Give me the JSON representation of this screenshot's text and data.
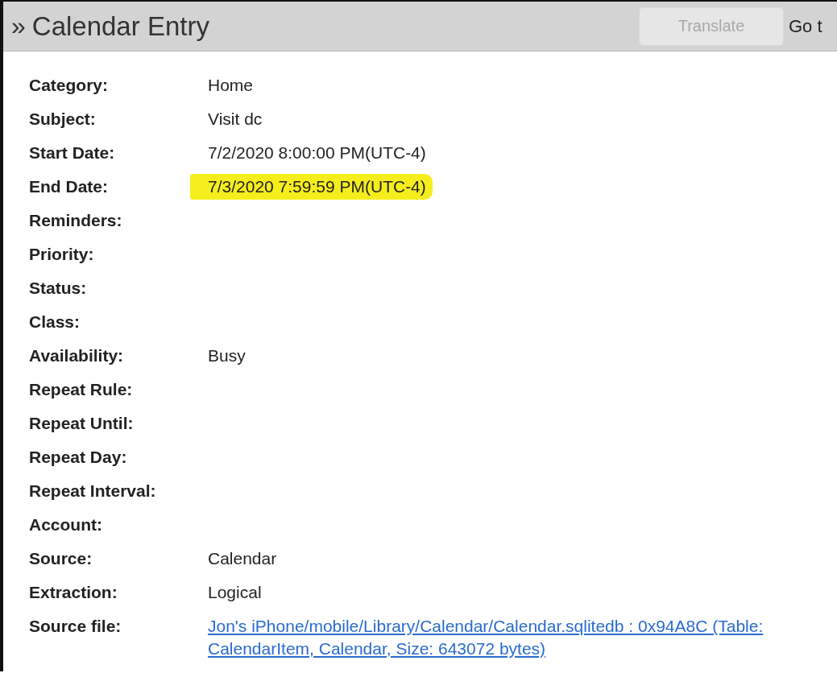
{
  "header": {
    "icon": "»",
    "title": "Calendar Entry",
    "translate_button": {
      "label": "Translate",
      "disabled": true
    },
    "go_to_link": "Go t"
  },
  "fields": [
    {
      "label": "Category:",
      "value": "Home",
      "kind": "text",
      "highlighted": false
    },
    {
      "label": "Subject:",
      "value": "Visit dc",
      "kind": "text",
      "highlighted": false
    },
    {
      "label": "Start Date:",
      "value": "7/2/2020 8:00:00 PM(UTC-4)",
      "kind": "text",
      "highlighted": false
    },
    {
      "label": "End Date:",
      "value": "7/3/2020 7:59:59 PM(UTC-4)",
      "kind": "text",
      "highlighted": true
    },
    {
      "label": "Reminders:",
      "highlighted": false
    },
    {
      "label": "Priority:",
      "highlighted": false
    },
    {
      "label": "Status:",
      "highlighted": false
    },
    {
      "label": "Class:",
      "highlighted": false
    },
    {
      "label": "Availability:",
      "value": "Busy",
      "kind": "text",
      "highlighted": false
    },
    {
      "label": "Repeat Rule:",
      "highlighted": false
    },
    {
      "label": "Repeat Until:",
      "highlighted": false
    },
    {
      "label": "Repeat Day:",
      "highlighted": false
    },
    {
      "label": "Repeat Interval:",
      "highlighted": false
    },
    {
      "label": "Account:",
      "highlighted": false
    },
    {
      "label": "Source:",
      "value": "Calendar",
      "kind": "text",
      "highlighted": false
    },
    {
      "label": "Extraction:",
      "value": "Logical",
      "kind": "text",
      "highlighted": false
    },
    {
      "label": "Source file:",
      "value": "Jon's iPhone/mobile/Library/Calendar/Calendar.sqlitedb : 0x94A8C (Table: CalendarItem, Calendar, Size: 643072 bytes)",
      "kind": "link",
      "highlighted": false
    }
  ]
}
